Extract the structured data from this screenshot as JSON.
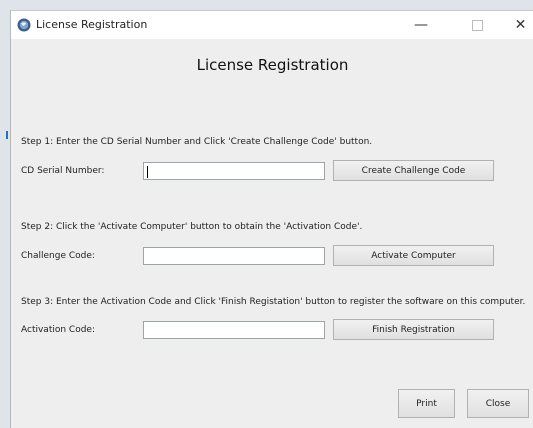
{
  "window": {
    "title": "License Registration",
    "controls": {
      "minimize": "—",
      "close": "✕"
    }
  },
  "heading": "License Registration",
  "steps": [
    {
      "instruction": "Step 1:   Enter the CD Serial Number and Click 'Create Challenge Code' button.",
      "field_label": "CD Serial Number:",
      "field_value": "",
      "button_label": "Create Challenge Code"
    },
    {
      "instruction": "Step 2:   Click the 'Activate Computer' button to obtain the 'Activation Code'.",
      "field_label": "Challenge Code:",
      "field_value": "",
      "button_label": "Activate Computer"
    },
    {
      "instruction": "Step 3:   Enter the Activation Code and Click 'Finish Registation' button to register the software on this computer.",
      "field_label": "Activation Code:",
      "field_value": "",
      "button_label": "Finish Registration"
    }
  ],
  "footer": {
    "print_label": "Print",
    "close_label": "Close"
  },
  "colors": {
    "accent": "#2a6fba",
    "window_bg": "#eeeeee",
    "titlebar_bg": "#ffffff"
  },
  "icons": {
    "app": "globe-icon"
  }
}
